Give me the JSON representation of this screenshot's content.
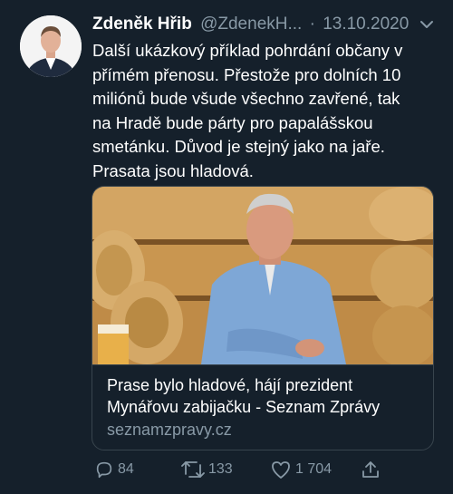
{
  "author": {
    "name": "Zdeněk Hřib",
    "handle": "@ZdenekH...",
    "date": "13.10.2020"
  },
  "tweet": {
    "text": "Další ukázkový příklad pohrdání občany v\npřímém přenosu. Přestože pro dolních 10\nmiliónů bude všude všechno zavřené, tak\nna Hradě bude párty pro papalášskou\nsmetánku. Důvod je stejný jako na jaře.\nPrasata jsou hladová."
  },
  "card": {
    "title": "Prase bylo hladové, hájí prezident\nMynářovu zabijačku - Seznam Zprávy",
    "domain": "seznamzpravy.cz"
  },
  "actions": {
    "replies": "84",
    "retweets": "133",
    "likes": "1 704"
  },
  "icons": {
    "menu": "chevron-down-icon",
    "reply": "reply-icon",
    "retweet": "retweet-icon",
    "like": "heart-icon",
    "share": "share-icon"
  },
  "colors": {
    "background": "#15202b",
    "secondary_text": "#8899a6",
    "border": "#38444d"
  }
}
